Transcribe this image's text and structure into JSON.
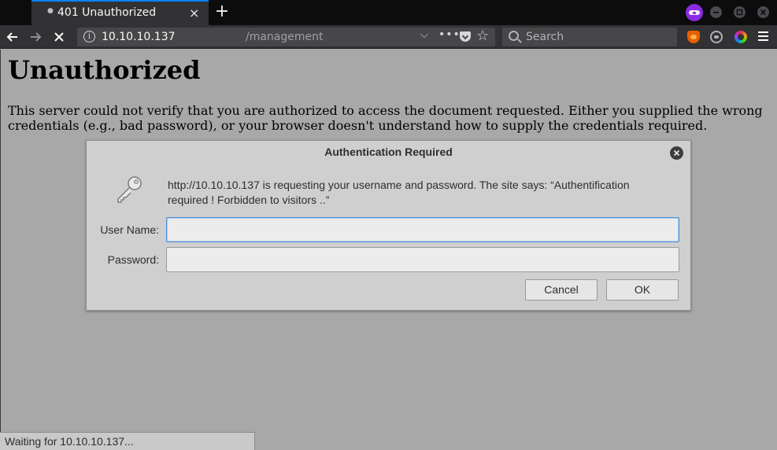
{
  "browser": {
    "tab": {
      "title": "401 Unauthorized",
      "close_glyph": "×",
      "icon": "loading-dot-icon"
    },
    "new_tab_glyph": "+",
    "window_controls": [
      "minimize-icon",
      "maximize-icon",
      "close-icon"
    ],
    "nav": {
      "back_glyph": "←",
      "forward_glyph": "→",
      "stop_glyph": "✕",
      "url_host": "10.10.10.137",
      "url_path": "/management",
      "search_placeholder": "Search"
    },
    "extensions": [
      "foxyproxy-icon",
      "hackbar-icon",
      "color-picker-icon"
    ],
    "status_text": "Waiting for 10.10.10.137..."
  },
  "page": {
    "heading": "Unauthorized",
    "body": "This server could not verify that you are authorized to access the document requested. Either you supplied the wrong credentials (e.g., bad password), or your browser doesn't understand how to supply the credentials required."
  },
  "dialog": {
    "title": "Authentication Required",
    "message": "http://10.10.10.137 is requesting your username and password. The site says: “Authentification required ! Forbidden to visitors ..”",
    "username_label": "User Name:",
    "username_value": "",
    "password_label": "Password:",
    "password_value": "",
    "cancel_label": "Cancel",
    "ok_label": "OK",
    "icon": "key-icon"
  },
  "colors": {
    "accent": "#0a84ff",
    "toolbar": "#323234",
    "tabstrip": "#0c0c0d",
    "page_overlay": "#a8a8a8",
    "private_badge": "#8a2be2"
  }
}
